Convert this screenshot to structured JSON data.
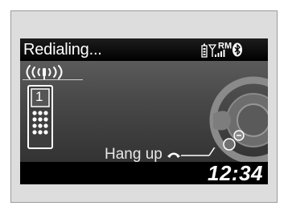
{
  "header": {
    "title": "Redialing...",
    "status": {
      "phone_battery_icon": "phone-battery-icon",
      "signal_icon": "signal-strength-icon",
      "roaming_label": "RM",
      "bluetooth_icon": "bluetooth-icon"
    }
  },
  "call": {
    "calling_icon": "calling-waves-icon",
    "phone_number_slot": "1",
    "hang_up_label": "Hang up",
    "hang_up_icon": "hang-up-phone-icon",
    "steering_wheel_icon": "steering-wheel-icon"
  },
  "footer": {
    "clock": "12:34"
  },
  "colors": {
    "screen_bg": "#3a3a3a",
    "header_bg": "#000000",
    "text": "#ffffff",
    "accent": "#ffffff"
  }
}
